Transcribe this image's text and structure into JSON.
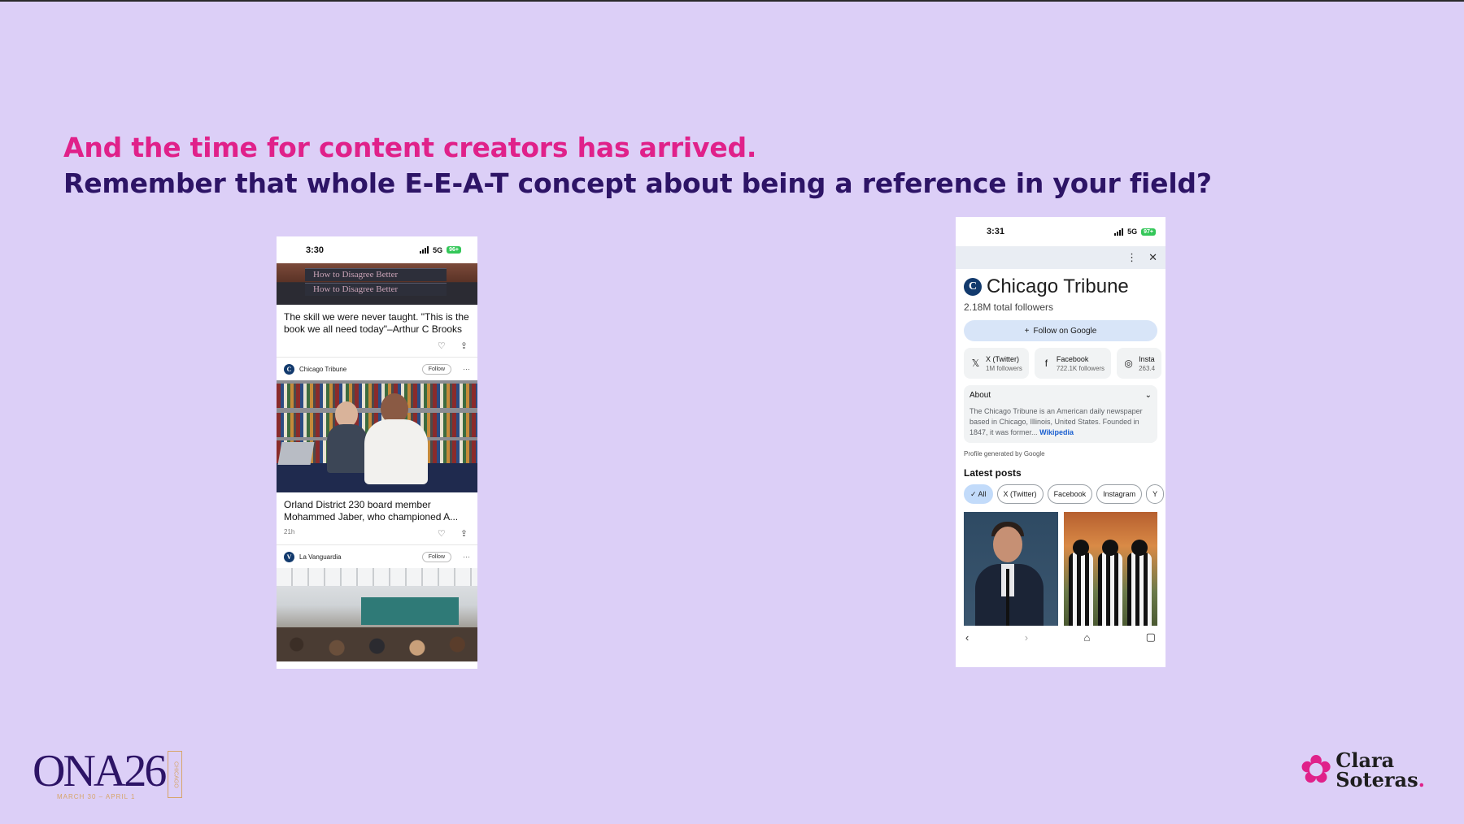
{
  "slide": {
    "headline_line1": "And the time for content creators has arrived.",
    "headline_line2": "Remember that whole E-E-A-T concept about being a reference in your field?"
  },
  "colors": {
    "background": "#dccff7",
    "accent_pink": "#e0218a",
    "navy": "#2d1466"
  },
  "phone1": {
    "status": {
      "time": "3:30",
      "network": "5G",
      "battery": "96+"
    },
    "book_spine_text": "How to Disagree Better",
    "book_spine_text_2": "How to Disagree Better",
    "article1_title": "The skill we were never taught. \"This is the book we all need today\"–Arthur C Brooks",
    "source1": {
      "name": "Chicago Tribune",
      "logo_letter": "C",
      "follow_label": "Follow",
      "more": "···"
    },
    "article2_title": "Orland District 230 board member Mohammed Jaber, who championed A...",
    "article2_time": "21h",
    "source2": {
      "name": "La Vanguardia",
      "logo_letter": "V",
      "follow_label": "Follow",
      "more": "···"
    },
    "icons": {
      "like": "heart-icon",
      "share": "share-icon"
    }
  },
  "phone2": {
    "status": {
      "time": "3:31",
      "network": "5G",
      "battery": "97+"
    },
    "top_icons": {
      "menu": "⋮",
      "close": "✕"
    },
    "publisher_logo_letter": "C",
    "publisher_name": "Chicago Tribune",
    "total_followers": "2.18M total followers",
    "follow_button": "Follow on Google",
    "follow_plus": "+",
    "socials": [
      {
        "name": "X (Twitter)",
        "count": "1M followers",
        "icon": "𝕏"
      },
      {
        "name": "Facebook",
        "count": "722.1K followers",
        "icon": "f"
      },
      {
        "name": "Insta",
        "count": "263.4",
        "icon": "◎"
      }
    ],
    "about": {
      "title": "About",
      "text": "The Chicago Tribune is an American daily newspaper based in Chicago, Illinois, United States. Founded in 1847, it was former",
      "ellipsis": "...",
      "link": "Wikipedia"
    },
    "profile_generated": "Profile generated by Google",
    "latest_posts_heading": "Latest posts",
    "filters": [
      {
        "label": "✓ All",
        "selected": true
      },
      {
        "label": "X (Twitter)",
        "selected": false
      },
      {
        "label": "Facebook",
        "selected": false
      },
      {
        "label": "Instagram",
        "selected": false
      },
      {
        "label": "Y",
        "selected": false
      }
    ],
    "nav_icons": {
      "back": "‹",
      "forward": "›",
      "home": "⌂",
      "tabs": "▢"
    }
  },
  "logos": {
    "ona_text": "ONA26",
    "ona_city": "CHICAGO",
    "ona_dates": "MARCH 30 – APRIL 1",
    "clara_line1": "Clara",
    "clara_line2": "Soteras",
    "clara_dot": "."
  }
}
